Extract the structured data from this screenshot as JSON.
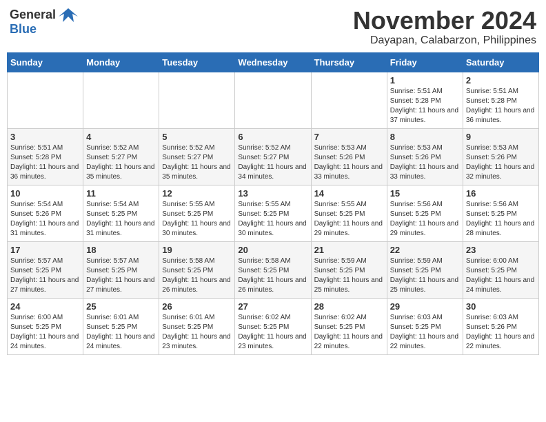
{
  "header": {
    "logo_general": "General",
    "logo_blue": "Blue",
    "title": "November 2024",
    "subtitle": "Dayapan, Calabarzon, Philippines"
  },
  "weekdays": [
    "Sunday",
    "Monday",
    "Tuesday",
    "Wednesday",
    "Thursday",
    "Friday",
    "Saturday"
  ],
  "weeks": [
    [
      {
        "day": "",
        "info": ""
      },
      {
        "day": "",
        "info": ""
      },
      {
        "day": "",
        "info": ""
      },
      {
        "day": "",
        "info": ""
      },
      {
        "day": "",
        "info": ""
      },
      {
        "day": "1",
        "info": "Sunrise: 5:51 AM\nSunset: 5:28 PM\nDaylight: 11 hours and 37 minutes."
      },
      {
        "day": "2",
        "info": "Sunrise: 5:51 AM\nSunset: 5:28 PM\nDaylight: 11 hours and 36 minutes."
      }
    ],
    [
      {
        "day": "3",
        "info": "Sunrise: 5:51 AM\nSunset: 5:28 PM\nDaylight: 11 hours and 36 minutes."
      },
      {
        "day": "4",
        "info": "Sunrise: 5:52 AM\nSunset: 5:27 PM\nDaylight: 11 hours and 35 minutes."
      },
      {
        "day": "5",
        "info": "Sunrise: 5:52 AM\nSunset: 5:27 PM\nDaylight: 11 hours and 35 minutes."
      },
      {
        "day": "6",
        "info": "Sunrise: 5:52 AM\nSunset: 5:27 PM\nDaylight: 11 hours and 34 minutes."
      },
      {
        "day": "7",
        "info": "Sunrise: 5:53 AM\nSunset: 5:26 PM\nDaylight: 11 hours and 33 minutes."
      },
      {
        "day": "8",
        "info": "Sunrise: 5:53 AM\nSunset: 5:26 PM\nDaylight: 11 hours and 33 minutes."
      },
      {
        "day": "9",
        "info": "Sunrise: 5:53 AM\nSunset: 5:26 PM\nDaylight: 11 hours and 32 minutes."
      }
    ],
    [
      {
        "day": "10",
        "info": "Sunrise: 5:54 AM\nSunset: 5:26 PM\nDaylight: 11 hours and 31 minutes."
      },
      {
        "day": "11",
        "info": "Sunrise: 5:54 AM\nSunset: 5:25 PM\nDaylight: 11 hours and 31 minutes."
      },
      {
        "day": "12",
        "info": "Sunrise: 5:55 AM\nSunset: 5:25 PM\nDaylight: 11 hours and 30 minutes."
      },
      {
        "day": "13",
        "info": "Sunrise: 5:55 AM\nSunset: 5:25 PM\nDaylight: 11 hours and 30 minutes."
      },
      {
        "day": "14",
        "info": "Sunrise: 5:55 AM\nSunset: 5:25 PM\nDaylight: 11 hours and 29 minutes."
      },
      {
        "day": "15",
        "info": "Sunrise: 5:56 AM\nSunset: 5:25 PM\nDaylight: 11 hours and 29 minutes."
      },
      {
        "day": "16",
        "info": "Sunrise: 5:56 AM\nSunset: 5:25 PM\nDaylight: 11 hours and 28 minutes."
      }
    ],
    [
      {
        "day": "17",
        "info": "Sunrise: 5:57 AM\nSunset: 5:25 PM\nDaylight: 11 hours and 27 minutes."
      },
      {
        "day": "18",
        "info": "Sunrise: 5:57 AM\nSunset: 5:25 PM\nDaylight: 11 hours and 27 minutes."
      },
      {
        "day": "19",
        "info": "Sunrise: 5:58 AM\nSunset: 5:25 PM\nDaylight: 11 hours and 26 minutes."
      },
      {
        "day": "20",
        "info": "Sunrise: 5:58 AM\nSunset: 5:25 PM\nDaylight: 11 hours and 26 minutes."
      },
      {
        "day": "21",
        "info": "Sunrise: 5:59 AM\nSunset: 5:25 PM\nDaylight: 11 hours and 25 minutes."
      },
      {
        "day": "22",
        "info": "Sunrise: 5:59 AM\nSunset: 5:25 PM\nDaylight: 11 hours and 25 minutes."
      },
      {
        "day": "23",
        "info": "Sunrise: 6:00 AM\nSunset: 5:25 PM\nDaylight: 11 hours and 24 minutes."
      }
    ],
    [
      {
        "day": "24",
        "info": "Sunrise: 6:00 AM\nSunset: 5:25 PM\nDaylight: 11 hours and 24 minutes."
      },
      {
        "day": "25",
        "info": "Sunrise: 6:01 AM\nSunset: 5:25 PM\nDaylight: 11 hours and 24 minutes."
      },
      {
        "day": "26",
        "info": "Sunrise: 6:01 AM\nSunset: 5:25 PM\nDaylight: 11 hours and 23 minutes."
      },
      {
        "day": "27",
        "info": "Sunrise: 6:02 AM\nSunset: 5:25 PM\nDaylight: 11 hours and 23 minutes."
      },
      {
        "day": "28",
        "info": "Sunrise: 6:02 AM\nSunset: 5:25 PM\nDaylight: 11 hours and 22 minutes."
      },
      {
        "day": "29",
        "info": "Sunrise: 6:03 AM\nSunset: 5:25 PM\nDaylight: 11 hours and 22 minutes."
      },
      {
        "day": "30",
        "info": "Sunrise: 6:03 AM\nSunset: 5:26 PM\nDaylight: 11 hours and 22 minutes."
      }
    ]
  ]
}
